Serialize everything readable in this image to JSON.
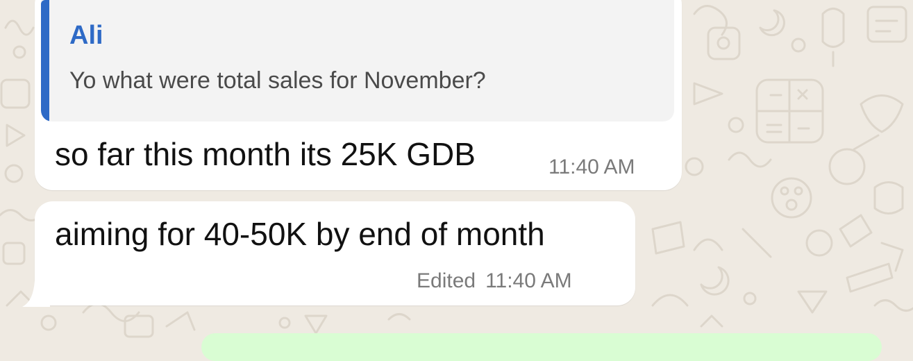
{
  "colors": {
    "chat_background": "#efeae2",
    "incoming_bubble": "#ffffff",
    "quote_background": "#f3f3f3",
    "quote_accent": "#2e6ac6",
    "outgoing_bubble": "#d9fdd3",
    "timestamp": "#7a7a7a"
  },
  "messages": [
    {
      "reply_to": {
        "sender": "Ali",
        "text": "Yo what were total sales for November?"
      },
      "text": "so far this month its 25K GDB",
      "time": "11:40 AM"
    },
    {
      "text": "aiming for 40-50K by end of month",
      "edited_label": "Edited",
      "time": "11:40 AM"
    }
  ]
}
